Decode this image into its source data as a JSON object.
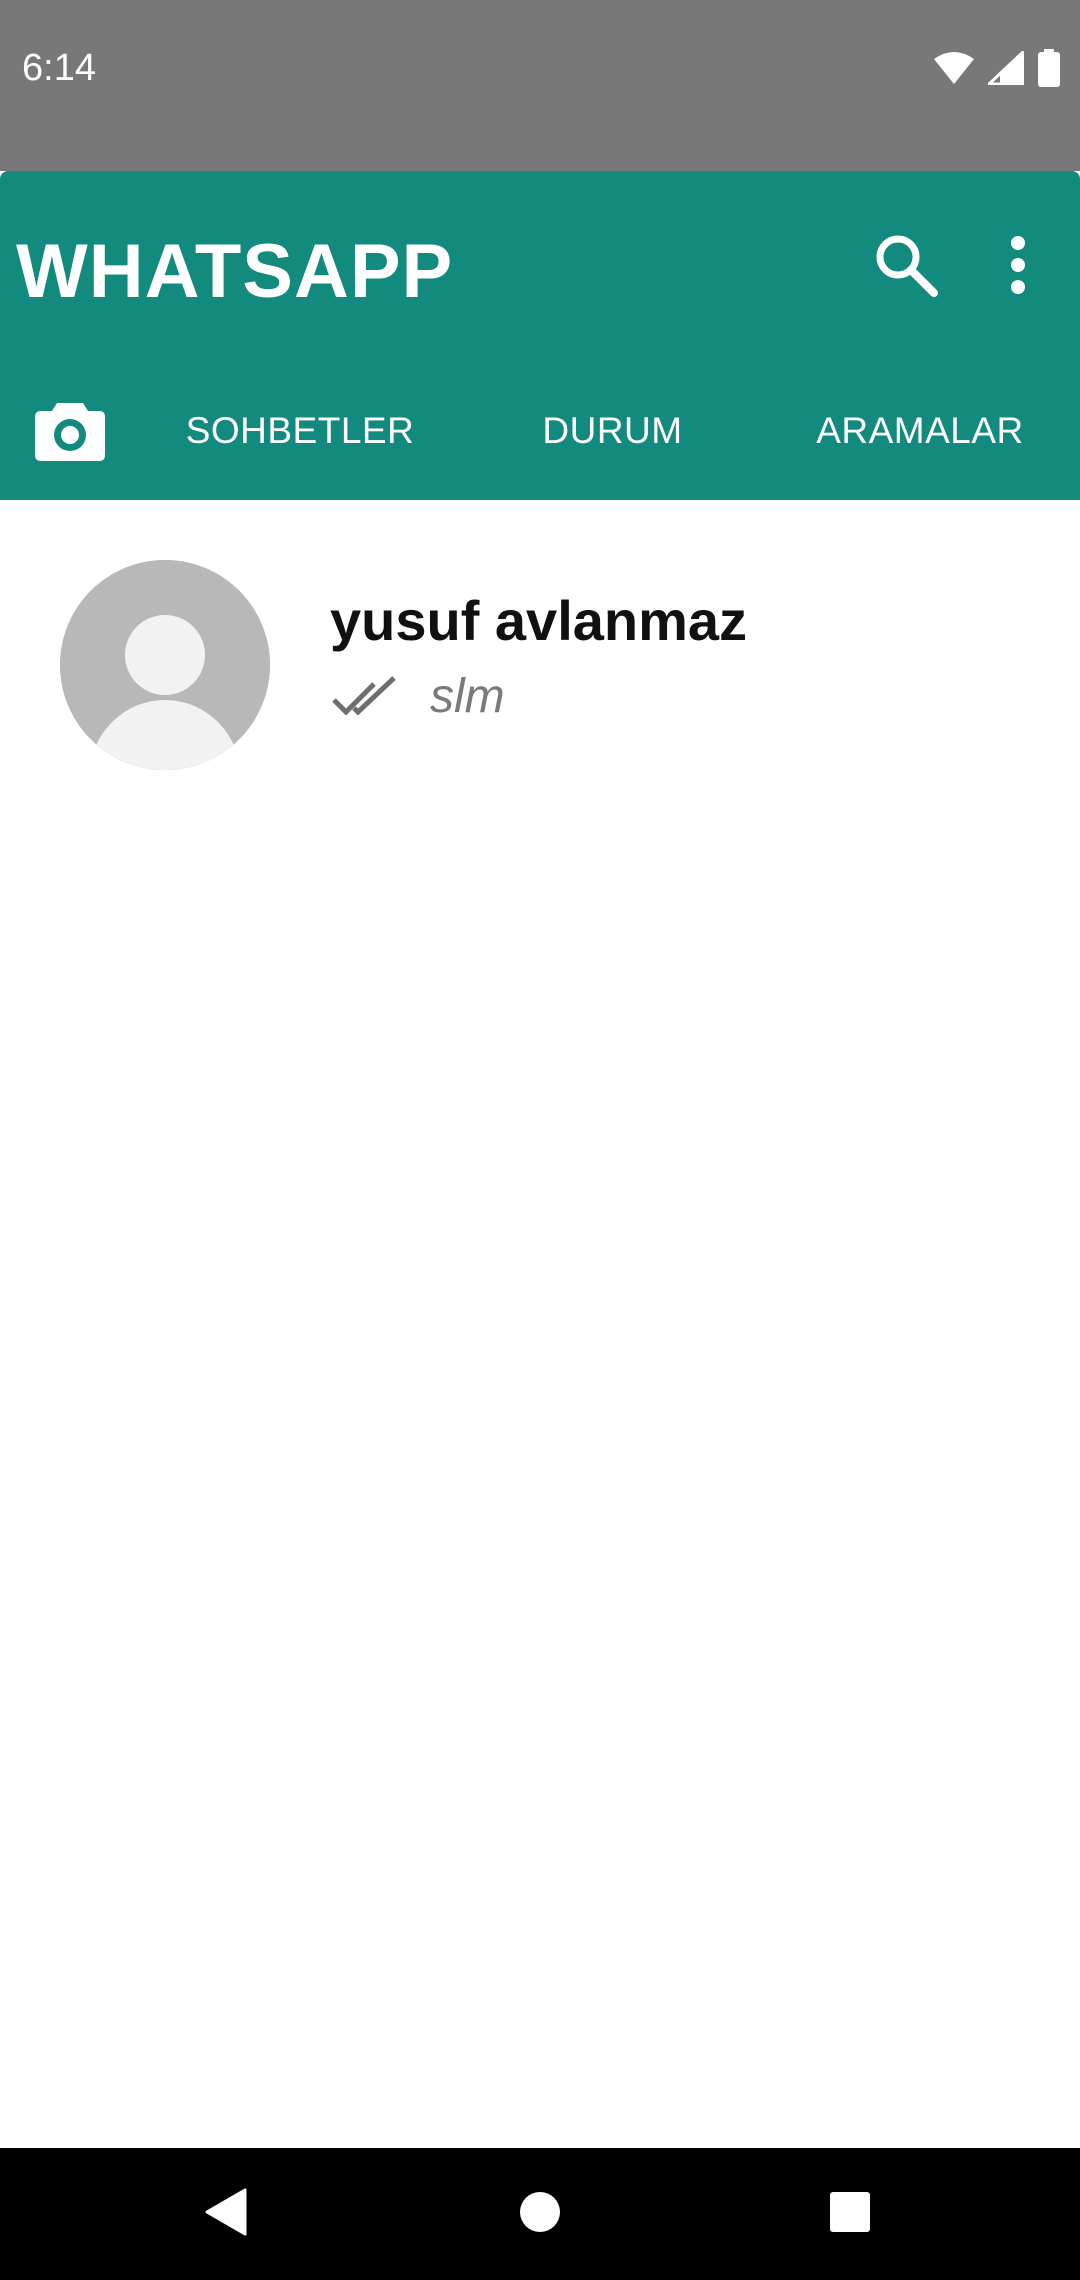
{
  "status_bar": {
    "time": "6:14",
    "icons": [
      "wifi-icon",
      "cell-signal-icon",
      "battery-icon"
    ]
  },
  "app_bar": {
    "title": "WHATSAPP",
    "actions": [
      "search-icon",
      "more-vert-icon"
    ],
    "color": "#138a7e"
  },
  "tabs": {
    "camera_icon": "camera-icon",
    "items": [
      {
        "label": "SOHBETLER"
      },
      {
        "label": "DURUM"
      },
      {
        "label": "ARAMALAR"
      }
    ]
  },
  "chats": [
    {
      "name": "yusuf avlanmaz",
      "last_message": "slm",
      "status_icon": "double-check-icon",
      "avatar": "default-avatar-icon"
    }
  ],
  "nav_bar": {
    "buttons": [
      "back-icon",
      "home-icon",
      "recents-icon"
    ]
  }
}
